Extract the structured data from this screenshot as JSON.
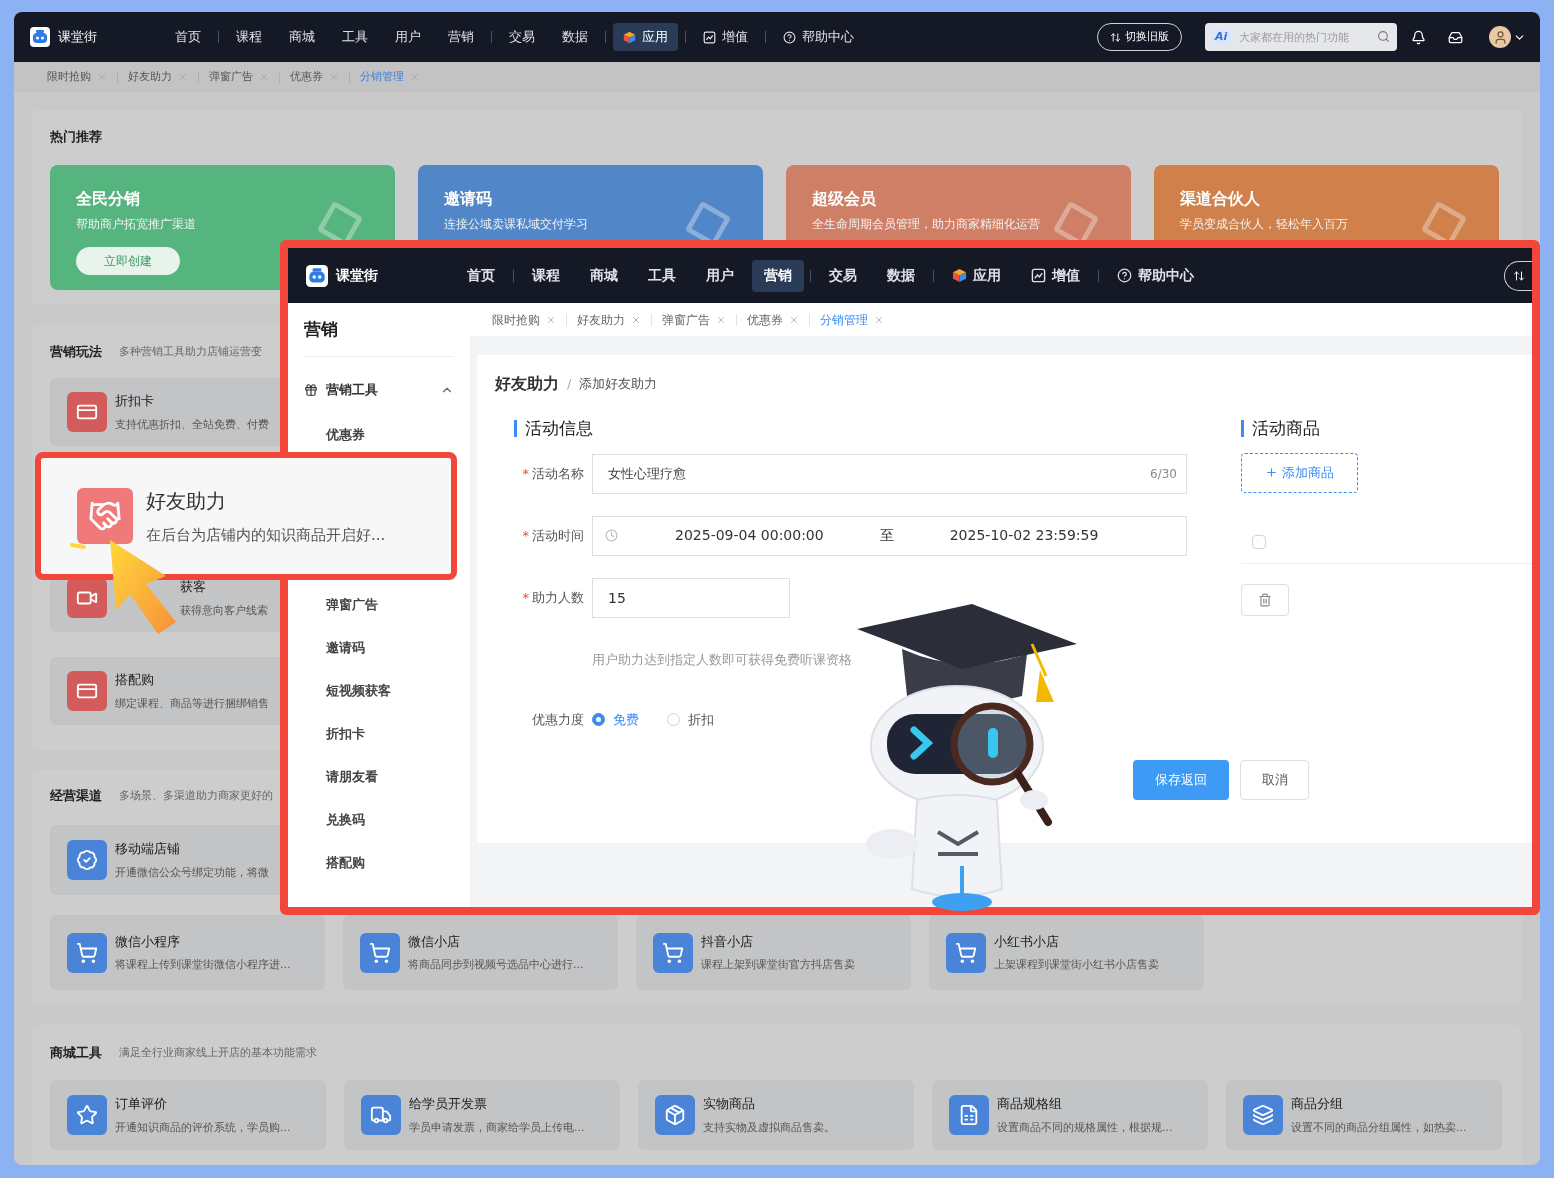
{
  "background": {
    "header": {
      "logo": "课堂街",
      "nav": [
        {
          "label": "首页",
          "kind": "text",
          "selected": false,
          "divider_after": true
        },
        {
          "label": "课程",
          "kind": "text",
          "selected": false,
          "divider_after": false
        },
        {
          "label": "商城",
          "kind": "text",
          "selected": false,
          "divider_after": false
        },
        {
          "label": "工具",
          "kind": "text",
          "selected": false,
          "divider_after": false
        },
        {
          "label": "用户",
          "kind": "text",
          "selected": false,
          "divider_after": false
        },
        {
          "label": "营销",
          "kind": "text",
          "selected": false,
          "divider_after": true
        },
        {
          "label": "交易",
          "kind": "text",
          "selected": false,
          "divider_after": false
        },
        {
          "label": "数据",
          "kind": "text",
          "selected": false,
          "divider_after": true
        },
        {
          "label": "应用",
          "kind": "apps",
          "selected": true,
          "divider_after": true
        },
        {
          "label": "增值",
          "kind": "growth",
          "selected": false,
          "divider_after": true
        },
        {
          "label": "帮助中心",
          "kind": "help",
          "selected": false,
          "divider_after": false
        }
      ],
      "switch_button": "切换旧版",
      "search": {
        "badge": "Ai",
        "placeholder": "大家都在用的热门功能"
      }
    },
    "tabs": [
      {
        "label": "限时抢购",
        "selected": false
      },
      {
        "label": "好友助力",
        "selected": false
      },
      {
        "label": "弹窗广告",
        "selected": false
      },
      {
        "label": "优惠券",
        "selected": false
      },
      {
        "label": "分销管理",
        "selected": true
      }
    ],
    "hot": {
      "title": "热门推荐",
      "cards": [
        {
          "title": "全民分销",
          "desc": "帮助商户拓宽推广渠道",
          "button": "立即创建",
          "color": "#56b47f"
        },
        {
          "title": "邀请码",
          "desc": "连接公域卖课私域交付学习",
          "color": "#5186c9"
        },
        {
          "title": "超级会员",
          "desc": "全生命周期会员管理，助力商家精细化运营",
          "color": "#cf7f66"
        },
        {
          "title": "渠道合伙人",
          "desc": "学员变成合伙人，轻松年入百万",
          "color": "#d0804a"
        }
      ]
    },
    "marketing": {
      "title": "营销玩法",
      "subtitle": "多种营销工具助力店铺运营变",
      "items": [
        {
          "title": "折扣卡",
          "desc": "支持优惠折扣、全站免费、付费"
        },
        {
          "title": "获客",
          "desc": "获得意向客户线索"
        },
        {
          "title": "搭配购",
          "desc": "绑定课程、商品等进行捆绑销售"
        }
      ]
    },
    "channels": {
      "title": "经营渠道",
      "subtitle": "多场景、多渠道助力商家更好的",
      "items": [
        {
          "title": "移动端店铺",
          "desc": "开通微信公众号绑定功能，将微"
        }
      ],
      "row_2": [
        {
          "title": "微信小程序",
          "desc": "将课程上传到课堂街微信小程序进..."
        },
        {
          "title": "微信小店",
          "desc": "将商品同步到视频号选品中心进行..."
        },
        {
          "title": "抖音小店",
          "desc": "课程上架到课堂街官方抖店售卖"
        },
        {
          "title": "小红书小店",
          "desc": "上架课程到课堂街小红书小店售卖"
        }
      ]
    },
    "mall_tools": {
      "title": "商城工具",
      "subtitle": "满足全行业商家线上开店的基本功能需求",
      "items": [
        {
          "title": "订单评价",
          "desc": "开通知识商品的评价系统，学员购..."
        },
        {
          "title": "给学员开发票",
          "desc": "学员申请发票，商家给学员上传电..."
        },
        {
          "title": "实物商品",
          "desc": "支持实物及虚拟商品售卖。"
        },
        {
          "title": "商品规格组",
          "desc": "设置商品不同的规格属性，根据规..."
        },
        {
          "title": "商品分组",
          "desc": "设置不同的商品分组属性，如热卖..."
        }
      ]
    }
  },
  "callout": {
    "title": "好友助力",
    "desc": "在后台为店铺内的知识商品开启好..."
  },
  "popup": {
    "header": {
      "logo": "课堂街",
      "nav": [
        {
          "label": "首页",
          "kind": "text",
          "selected": false,
          "divider_after": true
        },
        {
          "label": "课程",
          "kind": "text",
          "selected": false,
          "divider_after": false
        },
        {
          "label": "商城",
          "kind": "text",
          "selected": false,
          "divider_after": false
        },
        {
          "label": "工具",
          "kind": "text",
          "selected": false,
          "divider_after": false
        },
        {
          "label": "用户",
          "kind": "text",
          "selected": false,
          "divider_after": false
        },
        {
          "label": "营销",
          "kind": "text",
          "selected": true,
          "divider_after": true
        },
        {
          "label": "交易",
          "kind": "text",
          "selected": false,
          "divider_after": false
        },
        {
          "label": "数据",
          "kind": "text",
          "selected": false,
          "divider_after": true
        },
        {
          "label": "应用",
          "kind": "apps",
          "selected": false,
          "divider_after": false
        },
        {
          "label": "增值",
          "kind": "growth",
          "selected": false,
          "divider_after": true
        },
        {
          "label": "帮助中心",
          "kind": "help",
          "selected": false,
          "divider_after": false
        }
      ]
    },
    "sidebar": {
      "title": "营销",
      "group": {
        "label": "营销工具",
        "expanded": true,
        "children": [
          {
            "label": "优惠券"
          },
          {
            "label": "弹窗广告"
          },
          {
            "label": "邀请码"
          },
          {
            "label": "短视频获客"
          },
          {
            "label": "折扣卡"
          },
          {
            "label": "请朋友看"
          },
          {
            "label": "兑换码"
          },
          {
            "label": "搭配购"
          }
        ]
      }
    },
    "tabs": [
      {
        "label": "限时抢购",
        "selected": false
      },
      {
        "label": "好友助力",
        "selected": false
      },
      {
        "label": "弹窗广告",
        "selected": false
      },
      {
        "label": "优惠券",
        "selected": false
      },
      {
        "label": "分销管理",
        "selected": true
      }
    ],
    "breadcrumb": {
      "items": [
        "好友助力",
        "添加好友助力"
      ],
      "separator": "/"
    },
    "form": {
      "title": "活动信息",
      "fields": [
        {
          "kind": "text",
          "label": "活动名称",
          "required_mark": "*",
          "value": "女性心理疗愈",
          "counter": "6/30"
        },
        {
          "kind": "daterange",
          "label": "活动时间",
          "required_mark": "*",
          "start": "2025-09-04 00:00:00",
          "separator": "至",
          "end": "2025-10-02 23:59:59"
        },
        {
          "kind": "number",
          "label": "助力人数",
          "required_mark": "*",
          "value": "15",
          "hint": "用户助力达到指定人数即可获得免费听课资格"
        },
        {
          "kind": "radio",
          "label": "优惠力度",
          "options": [
            {
              "label": "免费",
              "selected": true
            },
            {
              "label": "折扣",
              "selected": false
            }
          ]
        }
      ],
      "buttons": [
        {
          "label": "保存返回",
          "kind": "primary"
        },
        {
          "label": "取消",
          "kind": "default"
        }
      ]
    },
    "goods": {
      "title": "活动商品",
      "add_button": "添加商品",
      "checked": false
    }
  }
}
